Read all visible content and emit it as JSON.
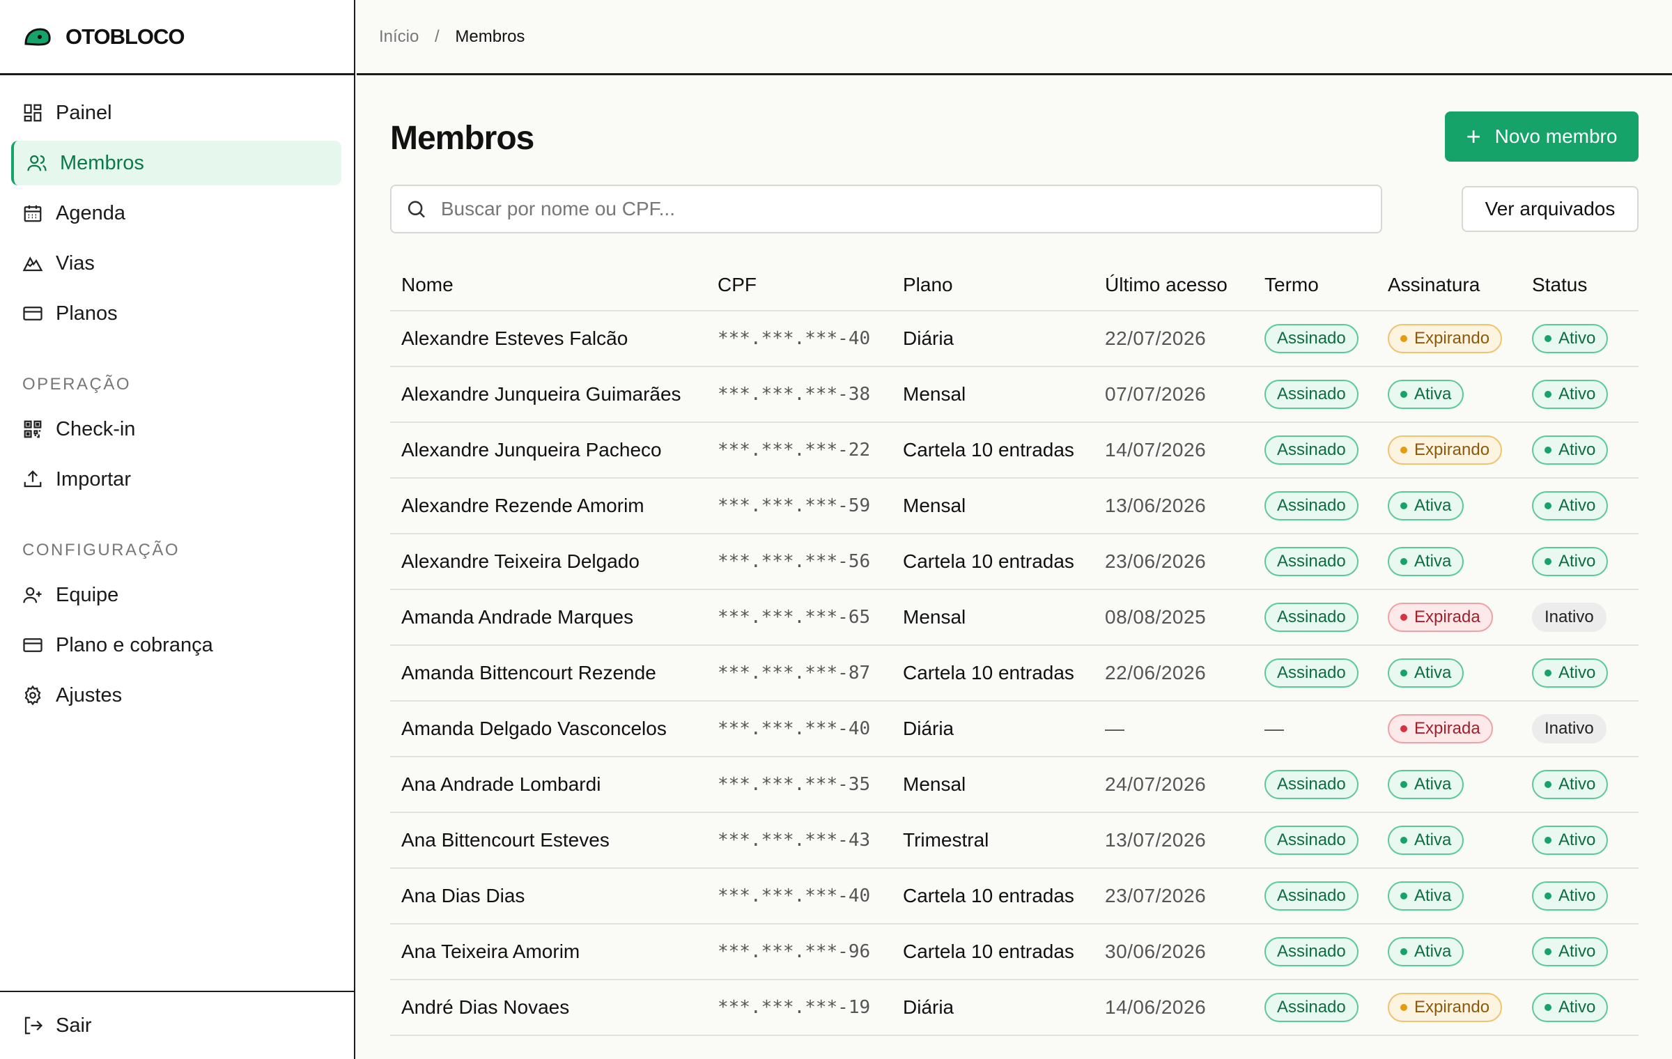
{
  "brand": {
    "name": "OTOBLOCO"
  },
  "breadcrumb": {
    "home": "Início",
    "separator": "/",
    "current": "Membros"
  },
  "nav": {
    "main": [
      {
        "label": "Painel",
        "icon": "grid-icon"
      },
      {
        "label": "Membros",
        "icon": "users-icon",
        "active": true
      },
      {
        "label": "Agenda",
        "icon": "calendar-icon"
      },
      {
        "label": "Vias",
        "icon": "mountain-icon"
      },
      {
        "label": "Planos",
        "icon": "card-icon"
      }
    ],
    "operation_title": "OPERAÇÃO",
    "operation": [
      {
        "label": "Check-in",
        "icon": "qr-icon"
      },
      {
        "label": "Importar",
        "icon": "upload-icon"
      }
    ],
    "config_title": "CONFIGURAÇÃO",
    "config": [
      {
        "label": "Equipe",
        "icon": "user-plus-icon"
      },
      {
        "label": "Plano e cobrança",
        "icon": "card-icon"
      },
      {
        "label": "Ajustes",
        "icon": "gear-icon"
      }
    ],
    "logout": "Sair"
  },
  "page": {
    "title": "Membros",
    "new_button": "Novo membro",
    "search_placeholder": "Buscar por nome ou CPF...",
    "archived_button": "Ver arquivados"
  },
  "table": {
    "columns": [
      "Nome",
      "CPF",
      "Plano",
      "Último acesso",
      "Termo",
      "Assinatura",
      "Status"
    ],
    "rows": [
      [
        "Alexandre Esteves Falcão",
        "***.***.***-40",
        "Diária",
        "22/07/2026",
        "Assinado",
        "Expirando",
        "Ativo"
      ],
      [
        "Alexandre Junqueira Guimarães",
        "***.***.***-38",
        "Mensal",
        "07/07/2026",
        "Assinado",
        "Ativa",
        "Ativo"
      ],
      [
        "Alexandre Junqueira Pacheco",
        "***.***.***-22",
        "Cartela 10 entradas",
        "14/07/2026",
        "Assinado",
        "Expirando",
        "Ativo"
      ],
      [
        "Alexandre Rezende Amorim",
        "***.***.***-59",
        "Mensal",
        "13/06/2026",
        "Assinado",
        "Ativa",
        "Ativo"
      ],
      [
        "Alexandre Teixeira Delgado",
        "***.***.***-56",
        "Cartela 10 entradas",
        "23/06/2026",
        "Assinado",
        "Ativa",
        "Ativo"
      ],
      [
        "Amanda Andrade Marques",
        "***.***.***-65",
        "Mensal",
        "08/08/2025",
        "Assinado",
        "Expirada",
        "Inativo"
      ],
      [
        "Amanda Bittencourt Rezende",
        "***.***.***-87",
        "Cartela 10 entradas",
        "22/06/2026",
        "Assinado",
        "Ativa",
        "Ativo"
      ],
      [
        "Amanda Delgado Vasconcelos",
        "***.***.***-40",
        "Diária",
        "—",
        "—",
        "Expirada",
        "Inativo"
      ],
      [
        "Ana Andrade Lombardi",
        "***.***.***-35",
        "Mensal",
        "24/07/2026",
        "Assinado",
        "Ativa",
        "Ativo"
      ],
      [
        "Ana Bittencourt Esteves",
        "***.***.***-43",
        "Trimestral",
        "13/07/2026",
        "Assinado",
        "Ativa",
        "Ativo"
      ],
      [
        "Ana Dias Dias",
        "***.***.***-40",
        "Cartela 10 entradas",
        "23/07/2026",
        "Assinado",
        "Ativa",
        "Ativo"
      ],
      [
        "Ana Teixeira Amorim",
        "***.***.***-96",
        "Cartela 10 entradas",
        "30/06/2026",
        "Assinado",
        "Ativa",
        "Ativo"
      ],
      [
        "André Dias Novaes",
        "***.***.***-19",
        "Diária",
        "14/06/2026",
        "Assinado",
        "Expirando",
        "Ativo"
      ]
    ]
  },
  "colors": {
    "accent": "#16a36a",
    "active_bg": "#e6f7ee",
    "warning": "#e69a10",
    "danger": "#d8323e"
  }
}
